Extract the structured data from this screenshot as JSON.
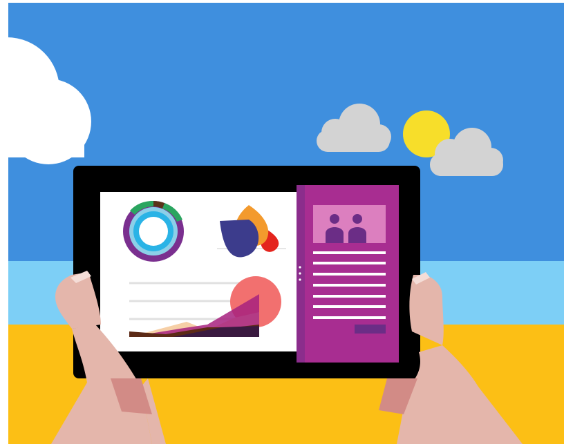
{
  "scene": {
    "description_icon": "tablet-illustration",
    "colors": {
      "sky": "#3f8fde",
      "horizon": "#7dcff6",
      "sand": "#fcbf15",
      "cloud_white": "#ffffff",
      "cloud_grey": "#d3d3d3",
      "sun": "#f7de2a",
      "tablet_body": "#000000",
      "screen_left": "#ffffff",
      "panel_purple": "#a82d91",
      "panel_edge": "#8b2d8c",
      "photo_bg": "#dc7fbf",
      "person": "#6b2d86",
      "skin": "#e4b6ab",
      "skin_shadow": "#d28b86",
      "nail": "#f4ddd7"
    }
  }
}
